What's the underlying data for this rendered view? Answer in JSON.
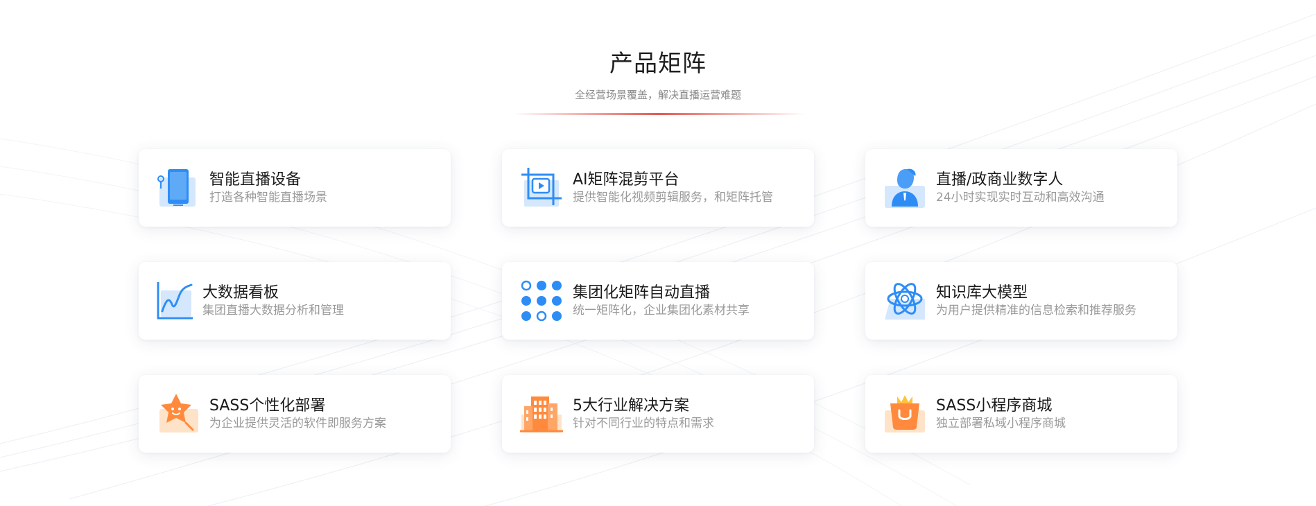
{
  "section": {
    "title": "产品矩阵",
    "subtitle": "全经营场景覆盖，解决直播运营难题"
  },
  "colors": {
    "accent_red": "#e0483e",
    "icon_blue": "#2e8df5",
    "icon_blue_light": "#cfe3fb",
    "icon_orange": "#ff8a3d",
    "icon_orange_light": "#ffe3c8"
  },
  "products": [
    {
      "title": "智能直播设备",
      "desc": "打造各种智能直播场景",
      "icon": "tablet-device-icon"
    },
    {
      "title": "AI矩阵混剪平台",
      "desc": "提供智能化视频剪辑服务，和矩阵托管",
      "icon": "video-crop-icon"
    },
    {
      "title": "直播/政商业数字人",
      "desc": "24小时实现实时互动和高效沟通",
      "icon": "digital-human-icon"
    },
    {
      "title": "大数据看板",
      "desc": "集团直播大数据分析和管理",
      "icon": "line-chart-icon"
    },
    {
      "title": "集团化矩阵自动直播",
      "desc": "统一矩阵化，企业集团化素材共享",
      "icon": "dot-matrix-icon"
    },
    {
      "title": "知识库大模型",
      "desc": "为用户提供精准的信息检索和推荐服务",
      "icon": "ai-knot-icon"
    },
    {
      "title": "SASS个性化部署",
      "desc": "为企业提供灵活的软件即服务方案",
      "icon": "star-mascot-icon"
    },
    {
      "title": "5大行业解决方案",
      "desc": "针对不同行业的特点和需求",
      "icon": "building-icon"
    },
    {
      "title": "SASS小程序商城",
      "desc": "独立部署私域小程序商城",
      "icon": "shopping-bag-icon"
    }
  ]
}
